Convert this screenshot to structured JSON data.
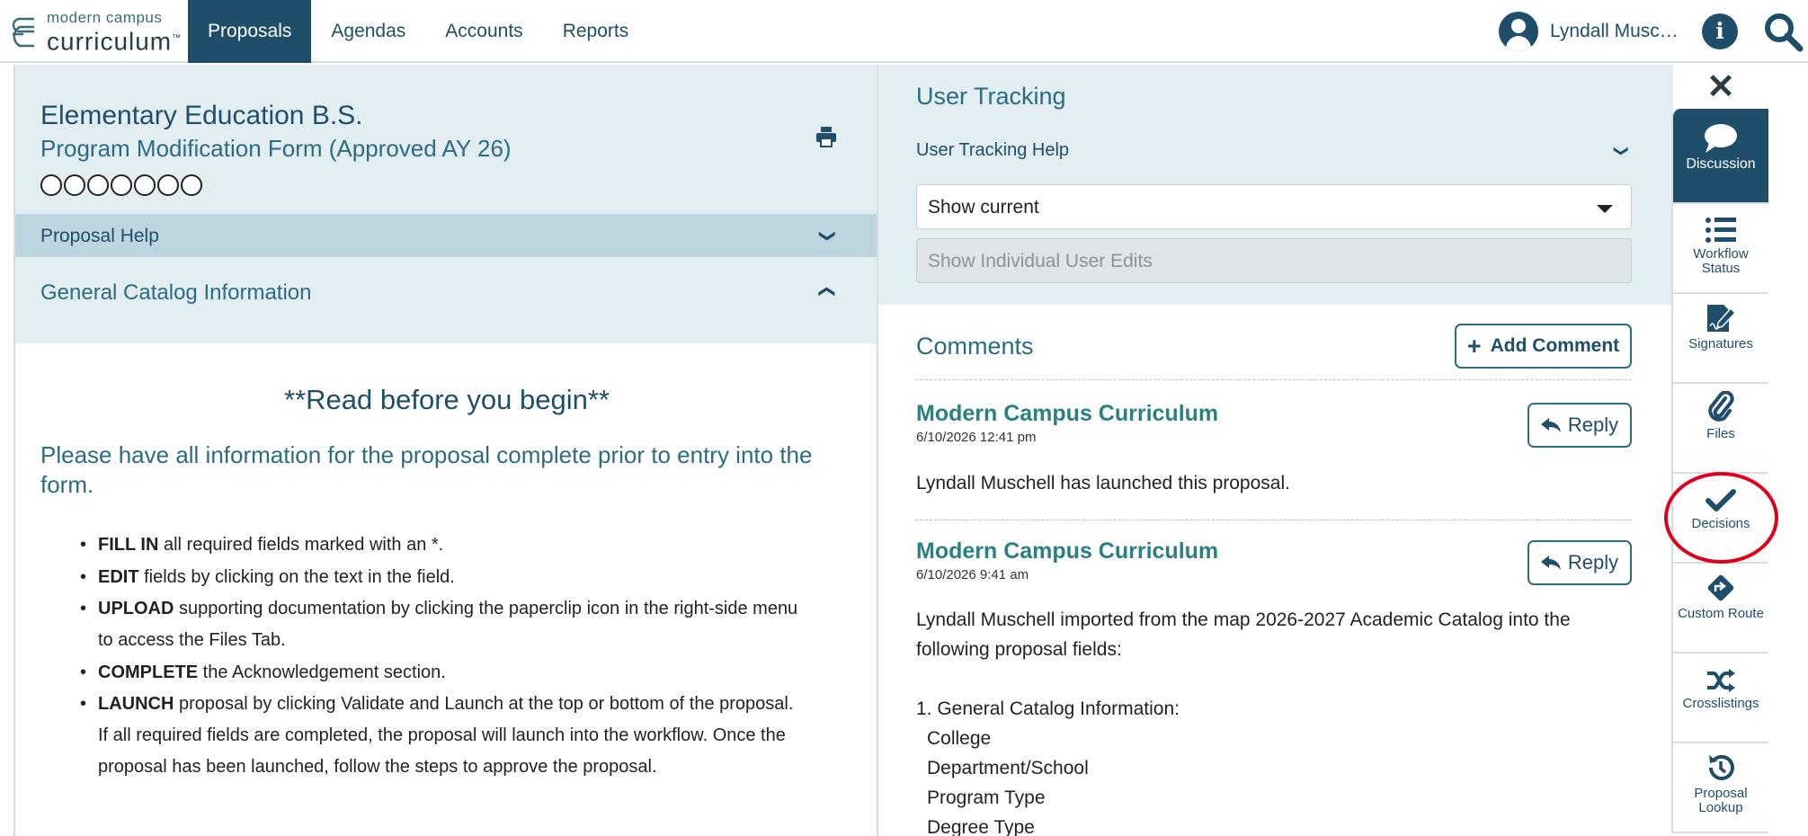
{
  "app": {
    "logo_top": "modern campus",
    "logo_main": "curriculum",
    "logo_tm": "™"
  },
  "nav": {
    "items": [
      {
        "label": "Proposals",
        "active": true
      },
      {
        "label": "Agendas",
        "active": false
      },
      {
        "label": "Accounts",
        "active": false
      },
      {
        "label": "Reports",
        "active": false
      }
    ]
  },
  "user": {
    "name": "Lyndall Musc…"
  },
  "proposal": {
    "title": "Elementary Education B.S.",
    "subtitle": "Program Modification Form (Approved AY 26)",
    "workflow_steps": 7,
    "help_label": "Proposal Help",
    "section_label": "General Catalog Information",
    "read_title": "**Read before you begin**",
    "intro": "Please have all information for the proposal complete prior to entry into the form.",
    "bullets": [
      {
        "bold": "FILL IN",
        "text": " all required fields marked with an *."
      },
      {
        "bold": "EDIT",
        "text": " fields by clicking on the text in the field."
      },
      {
        "bold": "UPLOAD",
        "text": " supporting documentation by clicking the paperclip icon in the right-side menu to access the Files Tab."
      },
      {
        "bold": "COMPLETE",
        "text": " the Acknowledgement section."
      },
      {
        "bold": "LAUNCH",
        "text": " proposal by clicking Validate and Launch at the top or bottom of the proposal.  If all required fields are completed, the proposal will launch into the workflow. Once the proposal has been launched, follow the steps to approve the proposal."
      }
    ]
  },
  "user_tracking": {
    "title": "User Tracking",
    "help_label": "User Tracking Help",
    "select_value": "Show current",
    "edits_button": "Show Individual User Edits"
  },
  "comments": {
    "title": "Comments",
    "add_label": "Add Comment",
    "reply_label": "Reply",
    "items": [
      {
        "author": "Modern Campus Curriculum",
        "time": "6/10/2026 12:41 pm",
        "body": "Lyndall Muschell has launched this proposal."
      },
      {
        "author": "Modern Campus Curriculum",
        "time": "6/10/2026 9:41 am",
        "body": "Lyndall Muschell imported from the map 2026-2027 Academic Catalog into the following proposal fields:",
        "list_head": "1. General Catalog Information:",
        "list": [
          "College",
          "Department/School",
          "Program Type",
          "Degree Type"
        ]
      }
    ]
  },
  "sidebar": {
    "close": "✕",
    "items": [
      {
        "label": "Discussion",
        "icon": "speech-bubble-icon",
        "active": true
      },
      {
        "label": "Workflow Status",
        "icon": "list-icon",
        "active": false
      },
      {
        "label": "Signatures",
        "icon": "signature-icon",
        "active": false
      },
      {
        "label": "Files",
        "icon": "paperclip-icon",
        "active": false
      },
      {
        "label": "Decisions",
        "icon": "checkmark-icon",
        "active": false
      },
      {
        "label": "Custom Route",
        "icon": "route-diamond-icon",
        "active": false
      },
      {
        "label": "Crosslistings",
        "icon": "shuffle-icon",
        "active": false
      },
      {
        "label": "Proposal Lookup",
        "icon": "history-icon",
        "active": false
      }
    ],
    "highlight": "Decisions"
  },
  "colors": {
    "primary": "#1f4e6b",
    "accent": "#2b6c83",
    "panel_bg": "#e3eef2",
    "help_bar_bg": "#bdd5de",
    "highlight_ring": "#e0001b"
  }
}
